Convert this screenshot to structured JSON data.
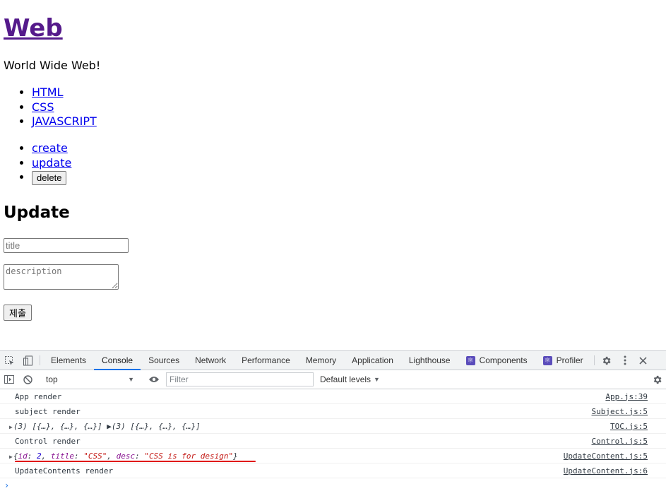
{
  "page": {
    "heading": "Web",
    "tagline": "World Wide Web!",
    "toc": [
      "HTML",
      "CSS",
      "JAVASCRIPT"
    ],
    "control": {
      "create": "create",
      "update": "update",
      "delete": "delete"
    },
    "form": {
      "title": "Update",
      "title_placeholder": "title",
      "desc_placeholder": "description",
      "submit": "제출"
    }
  },
  "devtools": {
    "tabs": [
      "Elements",
      "Console",
      "Sources",
      "Network",
      "Performance",
      "Memory",
      "Application",
      "Lighthouse",
      "Components",
      "Profiler"
    ],
    "active_tab": "Console",
    "toolbar": {
      "context": "top",
      "filter_placeholder": "Filter",
      "levels": "Default levels"
    },
    "logs": [
      {
        "msg": "App render",
        "src": "App.js:39"
      },
      {
        "msg": "subject render",
        "src": "Subject.js:5"
      },
      {
        "msg": "(3) [{…}, {…}, {…}] ▶(3) [{…}, {…}, {…}]",
        "src": "TOC.js:5"
      },
      {
        "msg": "Control render",
        "src": "Control.js:5"
      },
      {
        "msg": "{id: 2, title: \"CSS\", desc: \"CSS is for design\"}",
        "src": "UpdateContent.js:5"
      },
      {
        "msg": "UpdateContents render",
        "src": "UpdateContent.js:6"
      }
    ],
    "obj_parts": {
      "k_id": "id",
      "v_id": "2",
      "k_title": "title",
      "v_title": "\"CSS\"",
      "k_desc": "desc",
      "v_desc": "\"CSS is for design\""
    },
    "accent": "#1a73e8",
    "highlight": "#e00000"
  }
}
